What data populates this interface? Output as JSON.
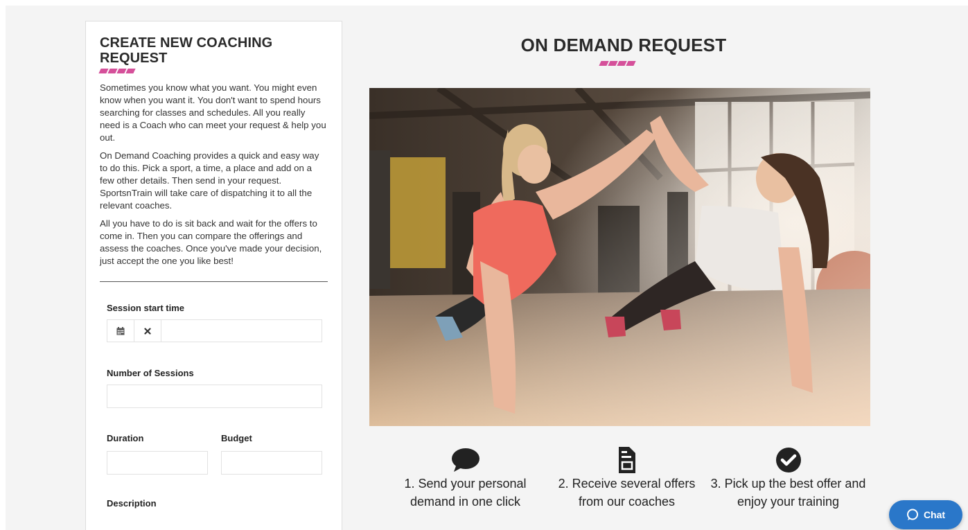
{
  "form_panel": {
    "title": "CREATE NEW COACHING REQUEST",
    "paragraphs": [
      "Sometimes you know what you want. You might even know when you want it. You don't want to spend hours searching for classes and schedules. All you really need is a Coach who can meet your request & help you out.",
      "On Demand Coaching provides a quick and easy way to do this. Pick a sport, a time, a place and add on a few other details. Then send in your request. SportsnTrain will take care of dispatching it to all the relevant coaches.",
      "All you have to do is sit back and wait for the offers to come in. Then you can compare the offerings and assess the coaches. Once you've made your decision, just accept the one you like best!"
    ],
    "fields": {
      "session_start_label": "Session start time",
      "number_sessions_label": "Number of Sessions",
      "duration_label": "Duration",
      "budget_label": "Budget",
      "description_label": "Description"
    },
    "icons": {
      "calendar": "calendar-icon",
      "clear": "close-icon"
    }
  },
  "main": {
    "title": "ON DEMAND REQUEST",
    "steps": [
      {
        "icon": "speech-bubble-icon",
        "text": "1. Send your personal demand in one click"
      },
      {
        "icon": "document-icon",
        "text": "2. Receive several offers from our coaches"
      },
      {
        "icon": "check-circle-icon",
        "text": "3. Pick up the best offer and enjoy your training"
      }
    ]
  },
  "chat": {
    "label": "Chat",
    "icon": "chat-bubble-icon"
  },
  "colors": {
    "accent": "#d5509a",
    "chat": "#2a77c9",
    "background": "#f4f4f4"
  }
}
